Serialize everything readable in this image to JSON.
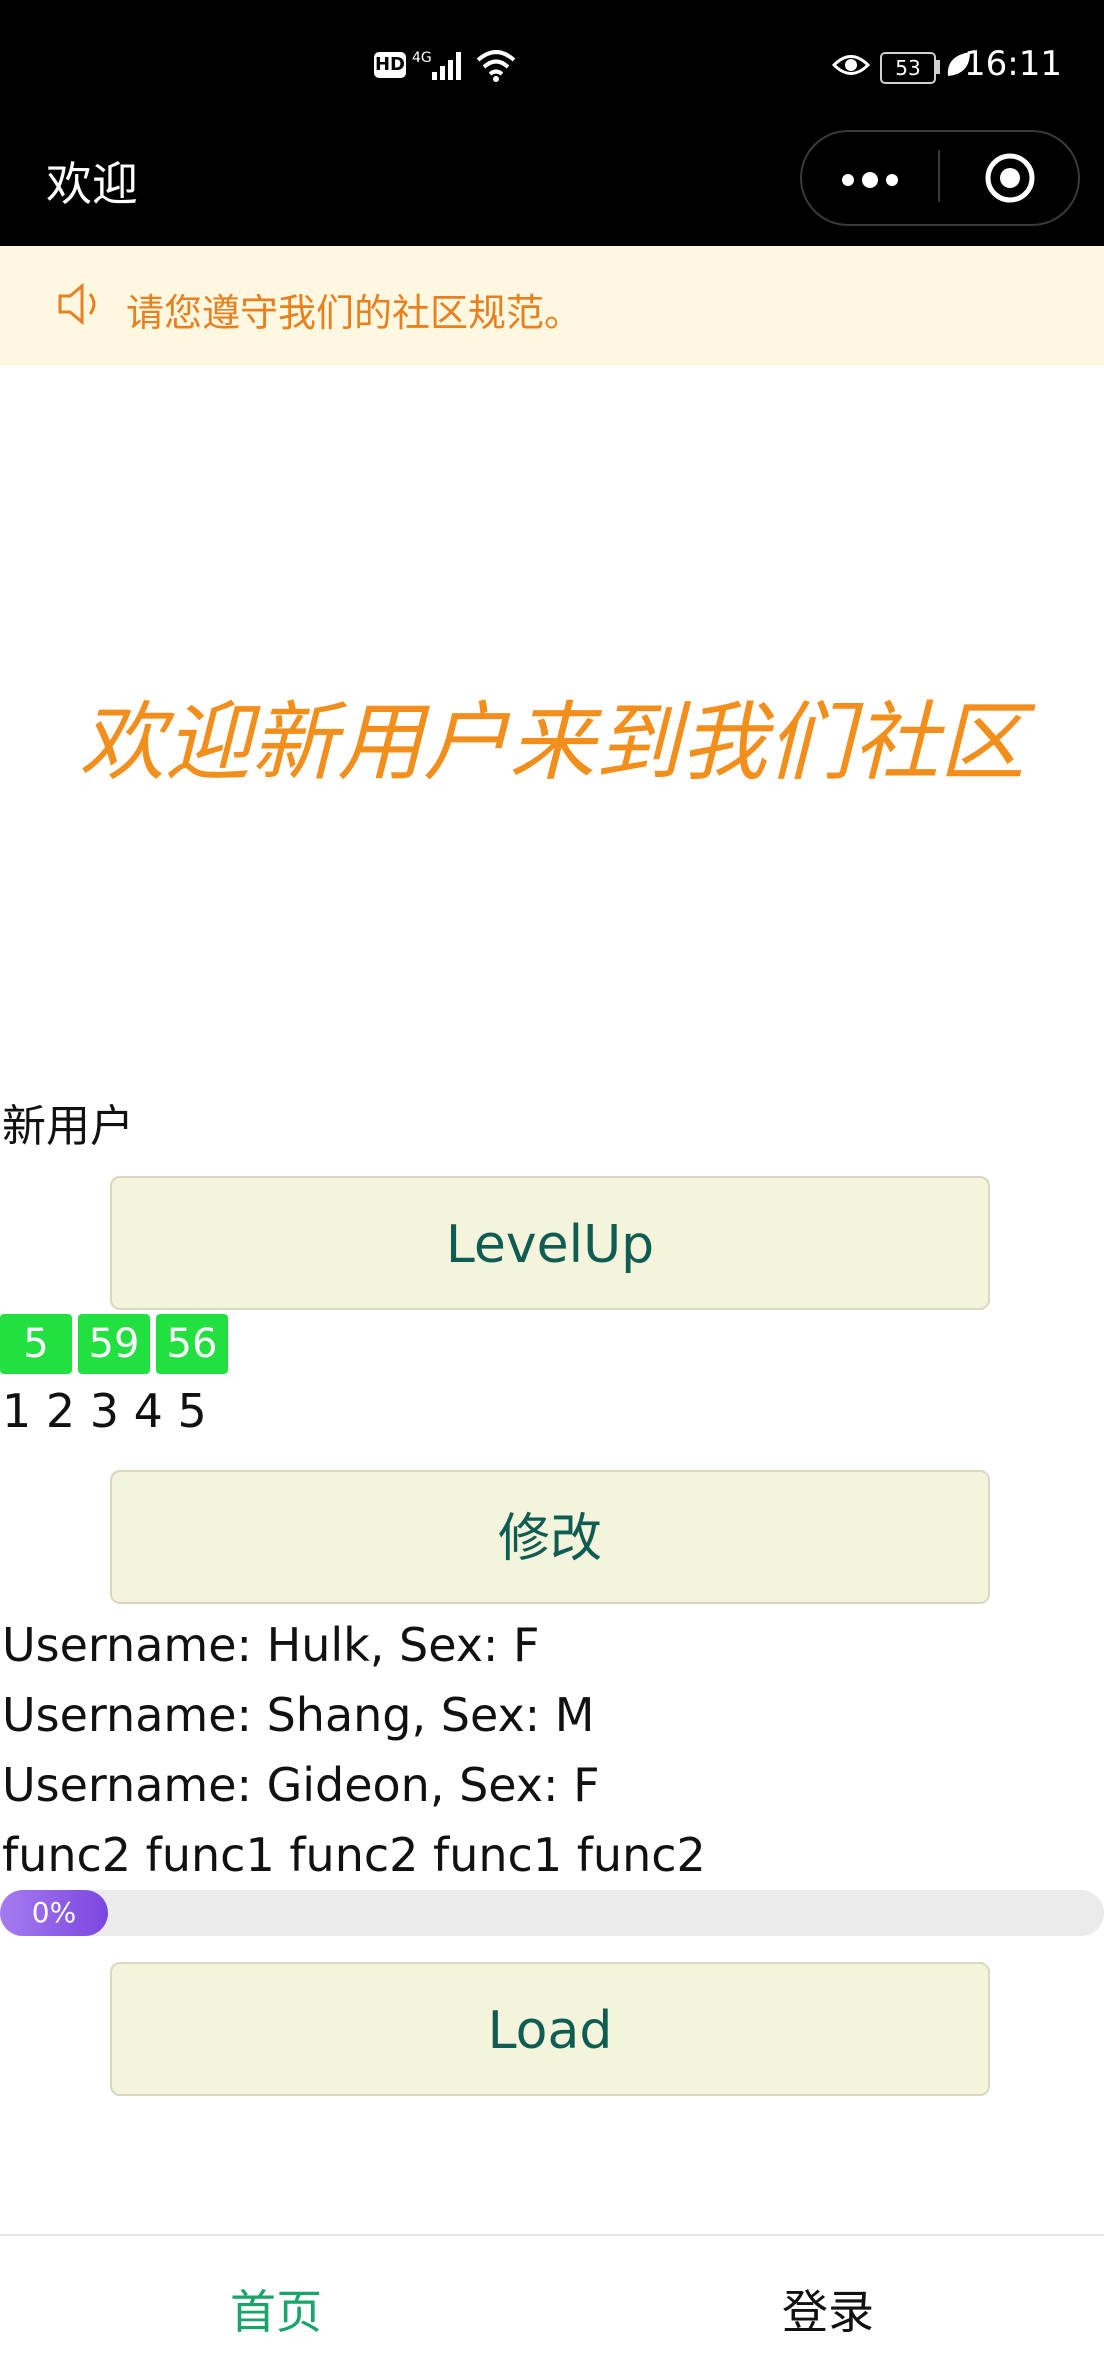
{
  "status_bar": {
    "time": "16:11",
    "battery": "53",
    "icons": [
      "hd-icon",
      "signal-icon",
      "wifi-icon",
      "eye-icon",
      "battery-icon",
      "leaf-icon"
    ]
  },
  "nav": {
    "title": "欢迎",
    "menu_icon": "more-dots-icon",
    "close_icon": "target-icon"
  },
  "notice": {
    "text": "请您遵守我们的社区规范。",
    "icon": "speaker-icon",
    "color": "#e8801f",
    "background": "#fff8e1"
  },
  "welcome": {
    "text": "欢迎新用户来到我们社区",
    "color": "#f28e1c"
  },
  "user_level": "新用户",
  "buttons": {
    "levelup": "LevelUp",
    "modify": "修改",
    "load": "Load"
  },
  "tags": [
    "5",
    "59",
    "56"
  ],
  "numbers": "1 2 3 4 5",
  "users": [
    "Username: Hulk, Sex: F",
    "Username: Shang, Sex: M",
    "Username: Gideon, Sex: F"
  ],
  "funcs": "func2 func1 func2 func1 func2",
  "progress": {
    "label": "0%",
    "value": 0
  },
  "tabbar": {
    "home": "首页",
    "login": "登录",
    "active_color": "#1aa36a"
  }
}
